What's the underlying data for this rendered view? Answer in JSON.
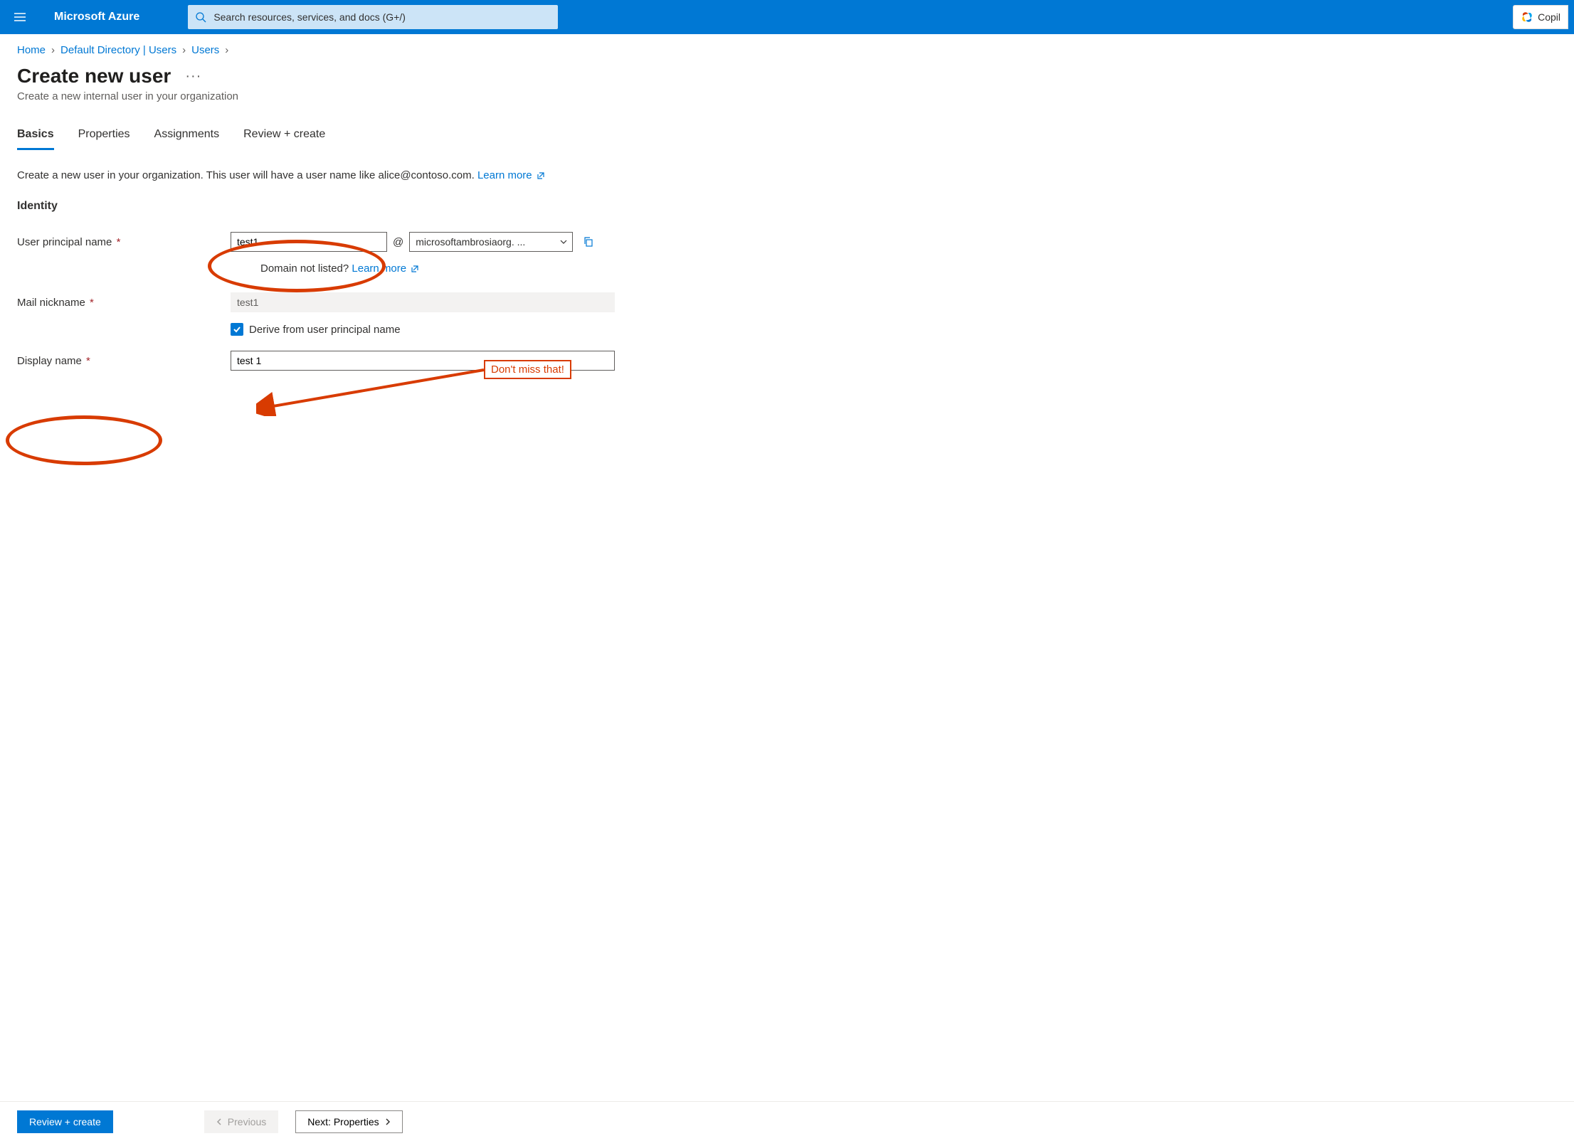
{
  "topbar": {
    "brand": "Microsoft Azure",
    "search_placeholder": "Search resources, services, and docs (G+/)",
    "copilot_label": "Copil"
  },
  "breadcrumbs": {
    "items": [
      "Home",
      "Default Directory | Users",
      "Users"
    ]
  },
  "page": {
    "title": "Create new user",
    "subtitle": "Create a new internal user in your organization"
  },
  "tabs": {
    "items": [
      "Basics",
      "Properties",
      "Assignments",
      "Review + create"
    ],
    "active_index": 0
  },
  "intro": {
    "text": "Create a new user in your organization. This user will have a user name like alice@contoso.com. ",
    "learn_more": "Learn more"
  },
  "section": "Identity",
  "form": {
    "upn_label": "User principal name",
    "upn_value": "test1",
    "at": "@",
    "domain_value": "microsoftambrosiaorg. ...",
    "domain_hint_prefix": "Domain not listed? ",
    "domain_hint_link": "Learn more",
    "mail_label": "Mail nickname",
    "mail_value": "test1",
    "derive_label": "Derive from user principal name",
    "display_label": "Display name",
    "display_value": "test 1"
  },
  "footer": {
    "review_create": "Review + create",
    "previous": "Previous",
    "next": "Next: Properties"
  },
  "annotations": {
    "callout": "Don't miss that!"
  }
}
